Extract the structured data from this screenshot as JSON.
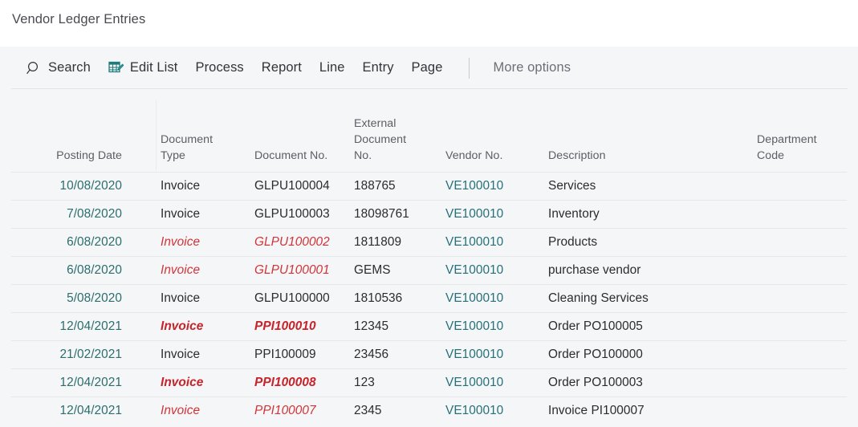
{
  "window": {
    "title": "Vendor Ledger Entries"
  },
  "commandbar": {
    "items": [
      {
        "label": "Search",
        "icon": "search-icon",
        "name": "search"
      },
      {
        "label": "Edit List",
        "icon": "edit-list-icon",
        "name": "edit-list"
      },
      {
        "label": "Process",
        "icon": "",
        "name": "process"
      },
      {
        "label": "Report",
        "icon": "",
        "name": "report"
      },
      {
        "label": "Line",
        "icon": "",
        "name": "line"
      },
      {
        "label": "Entry",
        "icon": "",
        "name": "entry"
      },
      {
        "label": "Page",
        "icon": "",
        "name": "page"
      }
    ],
    "more_options": "More options"
  },
  "grid": {
    "columns": [
      {
        "key": "posting_date",
        "label": "Posting Date"
      },
      {
        "key": "document_type",
        "label": "Document\nType"
      },
      {
        "key": "document_no",
        "label": "Document No."
      },
      {
        "key": "external_document_no",
        "label": "External\nDocument\nNo."
      },
      {
        "key": "vendor_no",
        "label": "Vendor No."
      },
      {
        "key": "description",
        "label": "Description"
      },
      {
        "key": "department_code",
        "label": "Department\nCode"
      }
    ],
    "rows": [
      {
        "posting_date": "10/08/2020",
        "document_type": "Invoice",
        "document_no": "GLPU100004",
        "external_document_no": "188765",
        "vendor_no": "VE100010",
        "description": "Services",
        "department_code": "",
        "style": "normal"
      },
      {
        "posting_date": "7/08/2020",
        "document_type": "Invoice",
        "document_no": "GLPU100003",
        "external_document_no": "18098761",
        "vendor_no": "VE100010",
        "description": "Inventory",
        "department_code": "",
        "style": "normal"
      },
      {
        "posting_date": "6/08/2020",
        "document_type": "Invoice",
        "document_no": "GLPU100002",
        "external_document_no": "1811809",
        "vendor_no": "VE100010",
        "description": "Products",
        "department_code": "",
        "style": "red-italic"
      },
      {
        "posting_date": "6/08/2020",
        "document_type": "Invoice",
        "document_no": "GLPU100001",
        "external_document_no": "GEMS",
        "vendor_no": "VE100010",
        "description": "purchase vendor",
        "department_code": "",
        "style": "red-italic"
      },
      {
        "posting_date": "5/08/2020",
        "document_type": "Invoice",
        "document_no": "GLPU100000",
        "external_document_no": "1810536",
        "vendor_no": "VE100010",
        "description": "Cleaning Services",
        "department_code": "",
        "style": "normal"
      },
      {
        "posting_date": "12/04/2021",
        "document_type": "Invoice",
        "document_no": "PPI100010",
        "external_document_no": "12345",
        "vendor_no": "VE100010",
        "description": "Order PO100005",
        "department_code": "",
        "style": "red-bold-italic"
      },
      {
        "posting_date": "21/02/2021",
        "document_type": "Invoice",
        "document_no": "PPI100009",
        "external_document_no": "23456",
        "vendor_no": "VE100010",
        "description": "Order PO100000",
        "department_code": "",
        "style": "normal"
      },
      {
        "posting_date": "12/04/2021",
        "document_type": "Invoice",
        "document_no": "PPI100008",
        "external_document_no": "123",
        "vendor_no": "VE100010",
        "description": "Order PO100003",
        "department_code": "",
        "style": "red-bold-italic"
      },
      {
        "posting_date": "12/04/2021",
        "document_type": "Invoice",
        "document_no": "PPI100007",
        "external_document_no": "2345",
        "vendor_no": "VE100010",
        "description": "Invoice PI100007",
        "department_code": "",
        "style": "red-italic"
      }
    ]
  },
  "colors": {
    "accent_teal": "#2c6d6d",
    "link_teal": "#25707a",
    "alert_red": "#d13438",
    "alert_red_bold": "#c8232a",
    "page_background": "#f5f6f7",
    "titlebar_background": "#ffffff",
    "row_divider": "#e6e7e9"
  }
}
